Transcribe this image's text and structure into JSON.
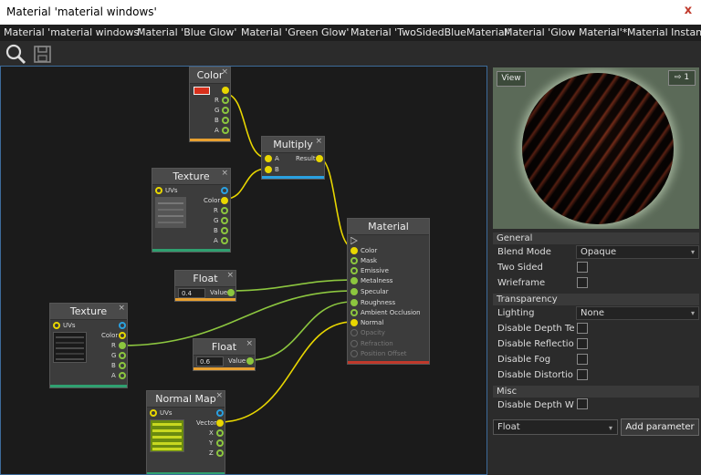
{
  "window": {
    "title": "Material 'material windows'",
    "close_glyph": "x"
  },
  "tabs": [
    "Material 'material windows'",
    "Material 'Blue Glow'",
    "Material 'Green Glow'",
    "Material 'TwoSidedBlueMaterial'",
    "Material 'Glow Material'*",
    "Material Instance '"
  ],
  "toolbar": {
    "search_icon": "magnifier-icon",
    "save_icon": "floppy-disk-icon"
  },
  "nodes": {
    "color": {
      "title": "Color",
      "ports": [
        "R",
        "G",
        "B",
        "A"
      ],
      "swatch_color": "#d8301c"
    },
    "multiply": {
      "title": "Multiply",
      "inputs": [
        "A",
        "B"
      ],
      "output": "Result"
    },
    "texture1": {
      "title": "Texture",
      "input": "UVs",
      "outputs": [
        "Color",
        "R",
        "G",
        "B",
        "A"
      ]
    },
    "float1": {
      "title": "Float",
      "value": "0.4",
      "output": "Value"
    },
    "material": {
      "title": "Material",
      "inputs": [
        "Color",
        "Mask",
        "Emissive",
        "Metalness",
        "Specular",
        "Roughness",
        "Ambient Occlusion",
        "Normal",
        "Opacity",
        "Refraction",
        "Position Offset"
      ]
    },
    "texture2": {
      "title": "Texture",
      "input": "UVs",
      "outputs": [
        "Color",
        "R",
        "G",
        "B",
        "A"
      ]
    },
    "float2": {
      "title": "Float",
      "value": "0.6",
      "output": "Value"
    },
    "normalmap": {
      "title": "Normal Map",
      "input": "UVs",
      "outputs": [
        "Vector",
        "X",
        "Y",
        "Z"
      ]
    },
    "close_glyph": "×"
  },
  "preview": {
    "view_label": "View",
    "pin_label": "1"
  },
  "properties": {
    "general": {
      "header": "General",
      "blend_mode_label": "Blend Mode",
      "blend_mode_value": "Opaque",
      "two_sided_label": "Two Sided",
      "wireframe_label": "Wrieframe"
    },
    "transparency": {
      "header": "Transparency",
      "lighting_label": "Lighting",
      "lighting_value": "None",
      "disable_depth_test_label": "Disable Depth Te",
      "disable_reflections_label": "Disable Reflectio",
      "disable_fog_label": "Disable Fog",
      "disable_distortion_label": "Disable Distortio"
    },
    "misc": {
      "header": "Misc",
      "disable_depth_write_label": "Disable Depth W"
    }
  },
  "parameters": {
    "type_value": "Float",
    "add_label": "Add parameter"
  },
  "colors": {
    "wire_yellow": "#e8d600",
    "wire_green": "#8cc63f",
    "accent_blue": "#2aa0e0",
    "accent_orange": "#e8a030",
    "accent_green": "#2fa070",
    "accent_red": "#c0392b"
  }
}
